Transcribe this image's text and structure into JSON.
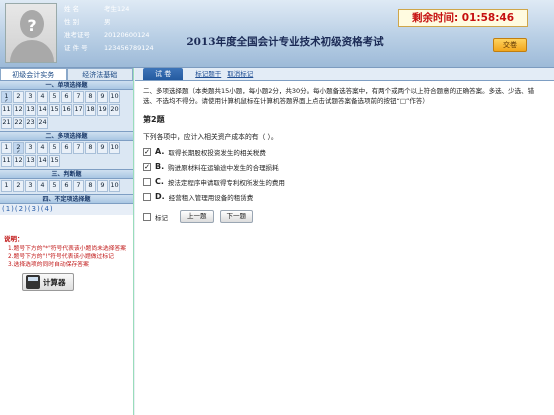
{
  "candidate": {
    "rows": [
      {
        "label": "姓   名",
        "value": "考生124"
      },
      {
        "label": "性   别",
        "value": "男"
      },
      {
        "label": "准考证号",
        "value": "20120600124"
      },
      {
        "label": "证 件 号",
        "value": "123456789124"
      }
    ]
  },
  "header": {
    "title": "2013年度全国会计专业技术初级资格考试",
    "timer": "剩余时间: 01:58:46",
    "submit_label": "交卷"
  },
  "subjects": [
    "初级会计实务",
    "经济法基础"
  ],
  "sections": [
    {
      "title": "一、单项选择题",
      "numbers": [
        "1",
        "2",
        "3",
        "4",
        "5",
        "6",
        "7",
        "8",
        "9",
        "10",
        "11",
        "12",
        "13",
        "14",
        "15",
        "16",
        "17",
        "18",
        "19",
        "20",
        "21",
        "22",
        "23",
        "24"
      ],
      "marks": [
        "✓",
        "",
        "",
        "",
        "",
        "",
        "",
        "",
        "",
        "",
        "",
        "",
        "",
        "",
        "",
        "",
        "",
        "",
        "",
        "",
        "",
        "",
        "",
        ""
      ]
    },
    {
      "title": "二、多项选择题",
      "numbers": [
        "1",
        "2",
        "3",
        "4",
        "5",
        "6",
        "7",
        "8",
        "9",
        "10",
        "11",
        "12",
        "13",
        "14",
        "15"
      ],
      "marks": [
        "",
        "✓",
        "",
        "",
        "",
        "",
        "",
        "",
        "",
        "",
        "",
        "",
        "",
        "",
        ""
      ]
    },
    {
      "title": "三、判断题",
      "numbers": [
        "1",
        "2",
        "3",
        "4",
        "5",
        "6",
        "7",
        "8",
        "9",
        "10"
      ],
      "marks": [
        "",
        "",
        "",
        "",
        "",
        "",
        "",
        "",
        "",
        ""
      ]
    },
    {
      "title": "四、不定项选择题",
      "numbers": [],
      "marks": []
    }
  ],
  "legend": "(1)(2)(3)(4)",
  "notes": {
    "title": "说明：",
    "lines": [
      "1.题号下方的\"*\"符号代表该小题尚未选择答案",
      "2.题号下方的\"!\"符号代表该小题做过标记",
      "3.选择选项的同时自动保存答案"
    ]
  },
  "calculator_label": "计算器",
  "main": {
    "tab": "试  卷",
    "links": [
      "标记题干",
      "取消标记"
    ],
    "instructions": "二、多项选择题（本类题共15小题，每小题2分，共30分。每小题备选答案中，有两个或两个以上符合题意的正确答案。多选、少选、错选、不选均不得分。请使用计算机鼠标在计算机答题界面上点击试题答案备选项前的按钮“□”作答）",
    "question_no": "第2题",
    "stem": "下列各项中，应计入相关资产成本的有（    ）。",
    "options": [
      {
        "letter": "A.",
        "text": "取得长期股权投资发生的相关税费",
        "checked": "✓"
      },
      {
        "letter": "B.",
        "text": "购进原材料在运输途中发生的合理损耗",
        "checked": "✓"
      },
      {
        "letter": "C.",
        "text": "按法定程序申请取得专利权所发生的费用",
        "checked": ""
      },
      {
        "letter": "D.",
        "text": "经营租入管理用设备的租赁费",
        "checked": ""
      }
    ],
    "mark_label": "标记",
    "prev_label": "上一题",
    "next_label": "下一题"
  }
}
